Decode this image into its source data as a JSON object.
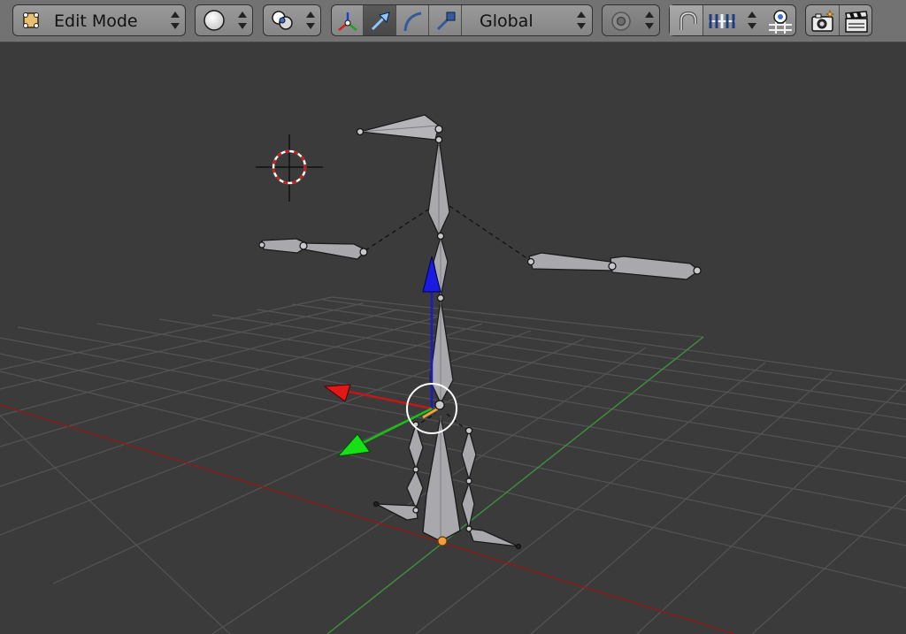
{
  "header": {
    "mode_selector": {
      "label": "Edit Mode",
      "icon": "armature-edit-icon"
    },
    "viewport_shading": {
      "icon": "solid-shading-icon"
    },
    "pivot_point": {
      "icon": "pivot-point-icon"
    },
    "manipulator": {
      "toggle_icon": "manipulator-toggle-icon",
      "translate_icon": "translate-manipulator-icon",
      "rotate_icon": "rotate-manipulator-icon",
      "scale_icon": "scale-manipulator-icon",
      "active": "translate"
    },
    "orientation": {
      "label": "Global"
    },
    "proportional_editing": {
      "icon": "proportional-edit-icon"
    },
    "snapping": {
      "toggle_icon": "magnet-icon",
      "element_icon": "snap-increment-icon",
      "target_icon": "snap-target-icon"
    },
    "render": {
      "opengl_still_icon": "camera-render-icon",
      "opengl_anim_icon": "clapperboard-icon"
    }
  },
  "viewport": {
    "background": "#3b3b3b",
    "grid_color": "#545454",
    "x_axis_color": "#8e1a1a",
    "y_axis_color": "#3f8f3f",
    "bone_color": "#a9a9ad",
    "selected_joint_color": "#f0a040"
  }
}
